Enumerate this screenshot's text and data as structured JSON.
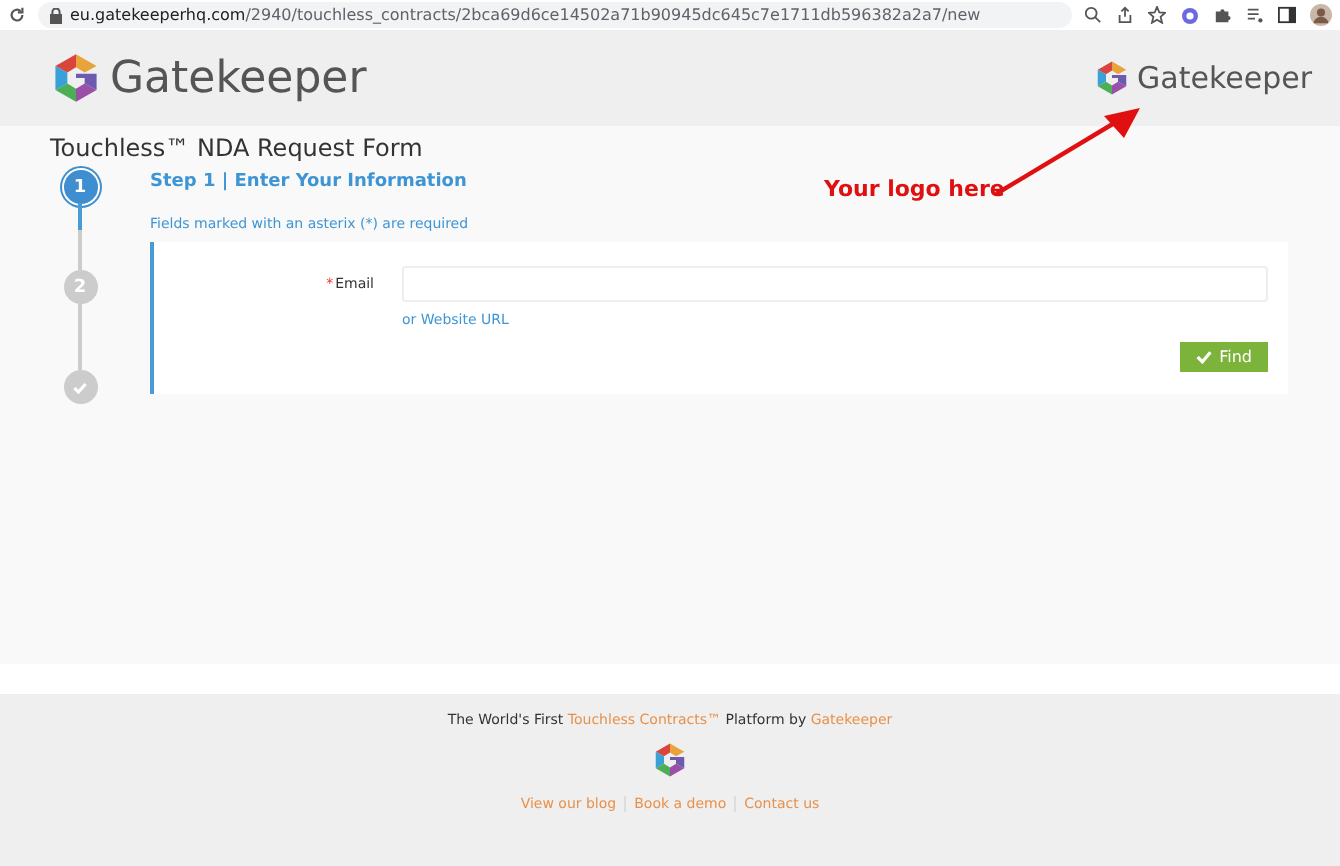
{
  "browser": {
    "url_host": "eu.gatekeeperhq.com",
    "url_path": "/2940/touchless_contracts/2bca69d6ce14502a71b90945dc645c7e1711db596382a2a7/new"
  },
  "header": {
    "logo_text": "Gatekeeper",
    "client_logo_text": "Gatekeeper"
  },
  "annotation": {
    "text": "Your logo here"
  },
  "form": {
    "title": "Touchless™ NDA Request Form",
    "steps": [
      {
        "kind": "number",
        "label": "1",
        "selected": true
      },
      {
        "kind": "number",
        "label": "2",
        "selected": false
      },
      {
        "kind": "check",
        "selected": false
      }
    ],
    "step_heading": "Step 1 | Enter Your Information",
    "required_note": "Fields marked with an asterix (*) are required",
    "fields": [
      {
        "label": "Email",
        "required_mark": "*"
      }
    ],
    "alt_link": "or Website URL",
    "button": "Find"
  },
  "footer": {
    "tagline_start": "The World's First ",
    "tagline_link": "Touchless Contracts™",
    "tagline_middle": " Platform by ",
    "tagline_brand": "Gatekeeper",
    "links": [
      "View our blog",
      "Book a demo",
      "Contact us"
    ]
  }
}
